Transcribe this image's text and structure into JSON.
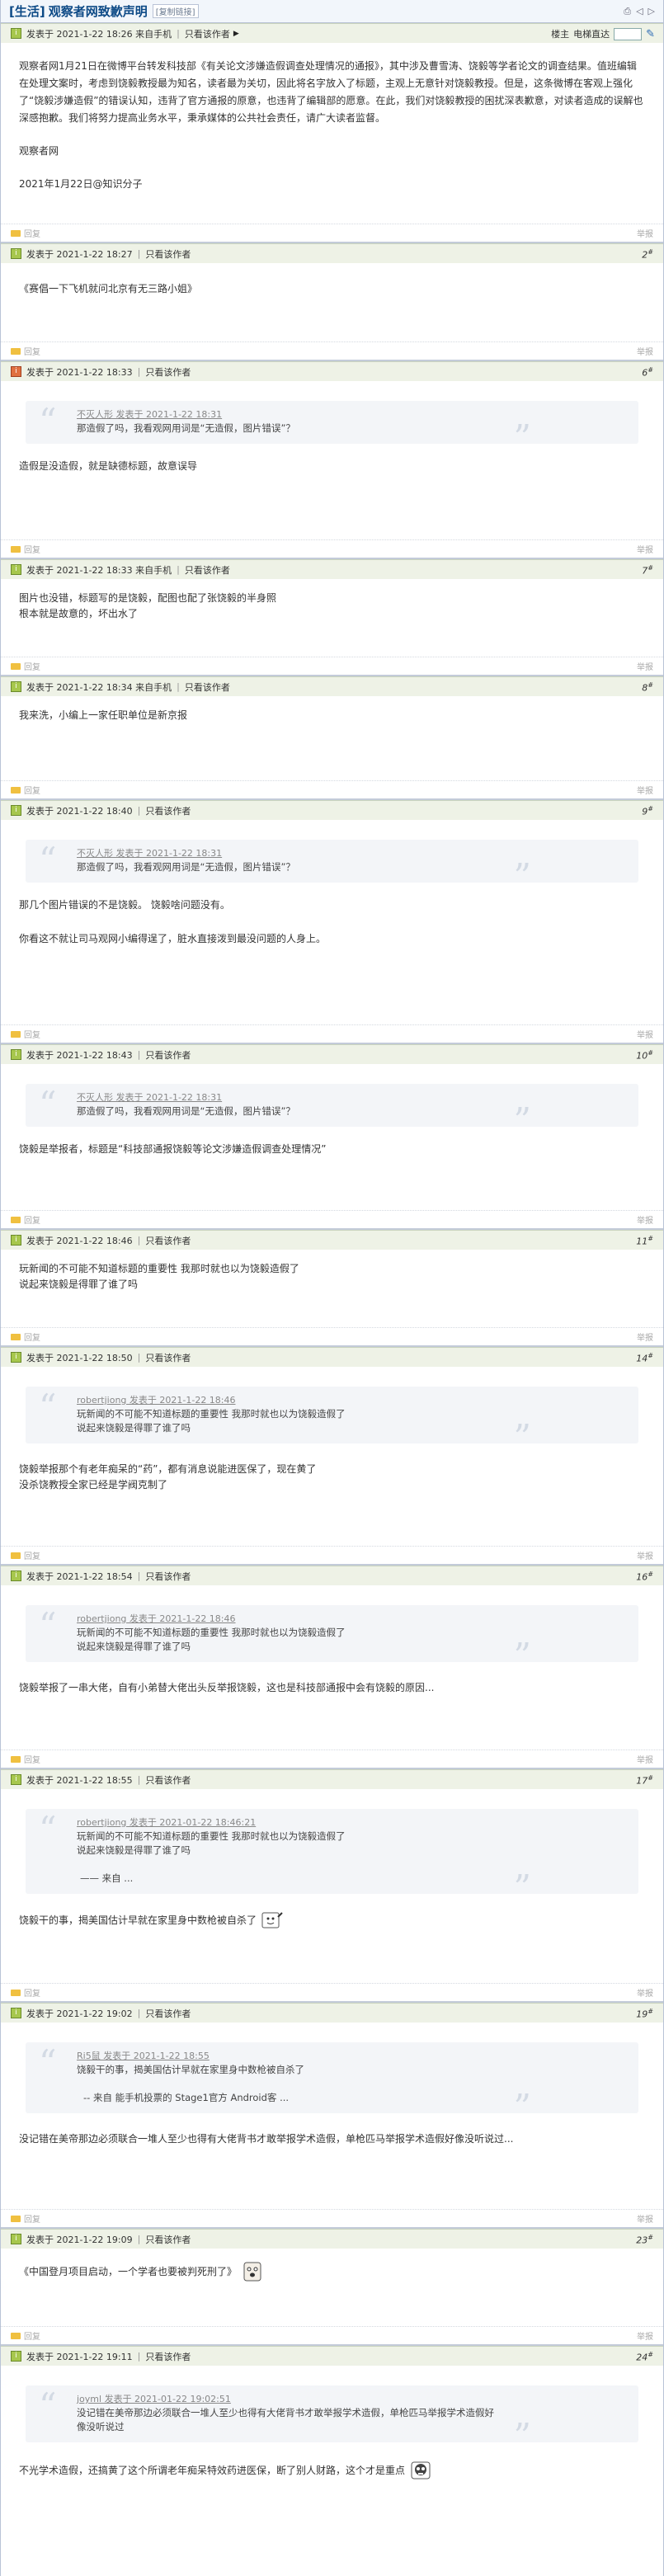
{
  "thread": {
    "category": "[生活]",
    "title": "观察者网致歉声明",
    "copy_link": "[复制链接]"
  },
  "labels": {
    "posted_on": "发表于",
    "only_author": "只看该作者",
    "reply": "回复",
    "report": "举报",
    "floor_label": "楼主",
    "elevator": "电梯直达"
  },
  "posts": [
    {
      "date": "2021-1-22 18:26 来自手机",
      "floor": "",
      "body": [
        "观察者网1月21日在微博平台转发科技部《有关论文涉嫌造假调查处理情况的通报》，其中涉及曹雪涛、饶毅等学者论文的调查结果。值班编辑在处理文案时，考虑到饶毅教授最为知名，读者最为关切，因此将名字放入了标题，主观上无意针对饶毅教授。但是，这条微博在客观上强化了“饶毅涉嫌造假”的错误认知，违背了官方通报的原意，也违背了编辑部的愿意。在此，我们对饶毅教授的困扰深表歉意，对读者造成的误解也深感抱歉。我们将努力提高业务水平，秉承媒体的公共社会责任，请广大读者监督。",
        "",
        "观察者网",
        "",
        "2021年1月22日@知识分子"
      ]
    },
    {
      "date": "2021-1-22 18:27",
      "floor": "2",
      "body": [
        "《赛倡一下飞机就问北京有无三路小姐》"
      ]
    },
    {
      "date": "2021-1-22 18:33",
      "floor": "6",
      "quote_head": "不灭人形 发表于 2021-1-22 18:31",
      "quote": [
        "那造假了吗，我看观网用词是“无造假，图片错误”？"
      ],
      "body": [
        "造假是没造假，就是缺德标题，故意误导"
      ]
    },
    {
      "date": "2021-1-22 18:33 来自手机",
      "floor": "7",
      "body": [
        "图片也没错，标题写的是饶毅，配图也配了张饶毅的半身照",
        "根本就是故意的，坏出水了"
      ]
    },
    {
      "date": "2021-1-22 18:34 来自手机",
      "floor": "8",
      "body": [
        "我来洗，小编上一家任职单位是新京报"
      ]
    },
    {
      "date": "2021-1-22 18:40",
      "floor": "9",
      "quote_head": "不灭人形 发表于 2021-1-22 18:31",
      "quote": [
        "那造假了吗，我看观网用词是“无造假，图片错误”？"
      ],
      "body": [
        "那几个图片错误的不是饶毅。 饶毅啥问题没有。",
        "",
        "你看这不就让司马观网小编得逞了，脏水直接泼到最没问题的人身上。"
      ]
    },
    {
      "date": "2021-1-22 18:43",
      "floor": "10",
      "quote_head": "不灭人形 发表于 2021-1-22 18:31",
      "quote": [
        "那造假了吗，我看观网用词是“无造假，图片错误”？"
      ],
      "body": [
        "饶毅是举报者，标题是“科技部通报饶毅等论文涉嫌造假调查处理情况”"
      ]
    },
    {
      "date": "2021-1-22 18:46",
      "floor": "11",
      "body": [
        "玩新闻的不可能不知道标题的重要性 我那时就也以为饶毅造假了",
        "说起来饶毅是得罪了谁了吗"
      ]
    },
    {
      "date": "2021-1-22 18:50",
      "floor": "14",
      "quote_head": "robertjiong 发表于 2021-1-22 18:46",
      "quote": [
        "玩新闻的不可能不知道标题的重要性 我那时就也以为饶毅造假了",
        "说起来饶毅是得罪了谁了吗"
      ],
      "body": [
        "饶毅举报那个有老年痴呆的“药”，都有消息说能进医保了，现在黄了",
        "没杀饶教授全家已经是学阀克制了"
      ]
    },
    {
      "date": "2021-1-22 18:54",
      "floor": "16",
      "quote_head": "robertjiong 发表于 2021-1-22 18:46",
      "quote": [
        "玩新闻的不可能不知道标题的重要性 我那时就也以为饶毅造假了",
        "说起来饶毅是得罪了谁了吗"
      ],
      "body": [
        "饶毅举报了一串大佬，自有小弟替大佬出头反举报饶毅，这也是科技部通报中会有饶毅的原因..."
      ]
    },
    {
      "date": "2021-1-22 18:55",
      "floor": "17",
      "quote_head": "robertjiong 发表于 2021-01-22 18:46:21",
      "quote": [
        "玩新闻的不可能不知道标题的重要性 我那时就也以为饶毅造假了",
        "说起来饶毅是得罪了谁了吗",
        "",
        "—— 来自 ..."
      ],
      "body": [
        "饶毅干的事，揭美国估计早就在家里身中数枪被自杀了"
      ]
    },
    {
      "date": "2021-1-22 19:02",
      "floor": "19",
      "quote_head": "Ri5鼠 发表于 2021-1-22 18:55",
      "quote": [
        "饶毅干的事，揭美国估计早就在家里身中数枪被自杀了",
        "",
        "-- 来自 能手机投票的 Stage1官方 Android客 ..."
      ],
      "body": [
        "没记错在美帝那边必须联合一堆人至少也得有大佬背书才敢举报学术造假，单枪匹马举报学术造假好像没听说过..."
      ]
    },
    {
      "date": "2021-1-22 19:09",
      "floor": "23",
      "body": [
        "《中国登月项目启动，一个学者也要被判死刑了》"
      ]
    },
    {
      "date": "2021-1-22 19:11",
      "floor": "24",
      "quote_head": "joyml 发表于 2021-01-22 19:02:51",
      "quote": [
        "没记错在美帝那边必须联合一堆人至少也得有大佬背书才敢举报学术造假，单枪匹马举报学术造假好",
        "像没听说过"
      ],
      "body": [
        "不光学术造假，还搞黄了这个所谓老年痴呆特效药进医保，断了别人财路，这个才是重点"
      ]
    }
  ]
}
